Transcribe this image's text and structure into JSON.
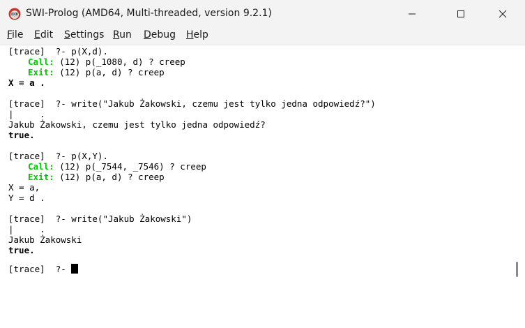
{
  "window": {
    "title": "SWI-Prolog (AMD64, Multi-threaded, version 9.2.1)",
    "icon": "swi-prolog-owl-icon"
  },
  "menu": {
    "file": "File",
    "edit": "Edit",
    "settings": "Settings",
    "run": "Run",
    "debug": "Debug",
    "help": "Help"
  },
  "colors": {
    "port_label": "#00c800",
    "background": "#ffffff"
  },
  "console": {
    "l1": "[trace]  ?- p(X,d).",
    "l2_label": "Call:",
    "l2_text": " (12) p(_1080, d) ? creep",
    "l3_label": "Exit:",
    "l3_text": " (12) p(a, d) ? creep",
    "l4": "X = a .",
    "l5": "[trace]  ?- write(\"Jakub Żakowski, czemu jest tylko jedna odpowiedź?\")",
    "l6": "|     .",
    "l7": "Jakub Żakowski, czemu jest tylko jedna odpowiedź?",
    "l8": "true.",
    "l9": "[trace]  ?- p(X,Y).",
    "l10_label": "Call:",
    "l10_text": " (12) p(_7544, _7546) ? creep",
    "l11_label": "Exit:",
    "l11_text": " (12) p(a, d) ? creep",
    "l12": "X = a,",
    "l13": "Y = d .",
    "l14": "[trace]  ?- write(\"Jakub Żakowski\")",
    "l15": "|     .",
    "l16": "Jakub Żakowski",
    "l17": "true.",
    "prompt": "[trace]  ?- "
  }
}
